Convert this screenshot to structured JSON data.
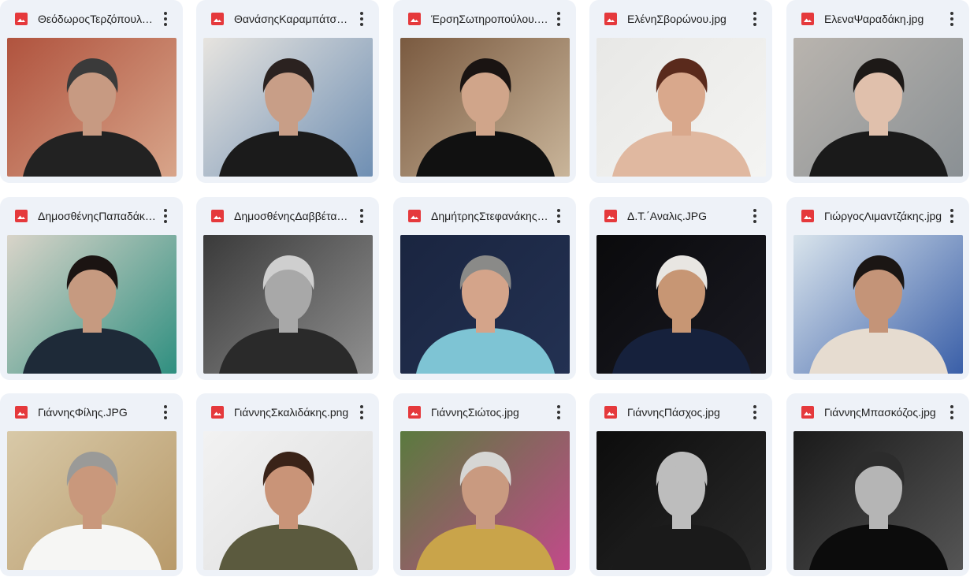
{
  "files": [
    {
      "name": "ΘεόδωροςΤερζόπουλος.jpg",
      "icon": "image-file-icon",
      "colors": {
        "bg": "#b0533e",
        "bg2": "#d8a58a",
        "skin": "#c79a82",
        "hair": "#3a3a3a",
        "shirt": "#222222"
      }
    },
    {
      "name": "ΘανάσηςΚαραμπάτσος.jpg",
      "icon": "image-file-icon",
      "colors": {
        "bg": "#e7e4df",
        "bg2": "#6f8fb3",
        "skin": "#c89e87",
        "hair": "#2b2220",
        "shirt": "#1b1b1b"
      }
    },
    {
      "name": "ΈρσηΣωτηροπούλου.jpg",
      "icon": "image-file-icon",
      "colors": {
        "bg": "#7a5a40",
        "bg2": "#c9b59a",
        "skin": "#d0a58a",
        "hair": "#1a1412",
        "shirt": "#111111"
      }
    },
    {
      "name": "ΕλένηΣβορώνου.jpg",
      "icon": "image-file-icon",
      "colors": {
        "bg": "#e8e8e6",
        "bg2": "#f4f4f2",
        "skin": "#d9a88c",
        "hair": "#5a2a1c",
        "shirt": "#e0b8a0"
      }
    },
    {
      "name": "ΕλεναΨαραδάκη.jpg",
      "icon": "image-file-icon",
      "colors": {
        "bg": "#b9b4ae",
        "bg2": "#8a9094",
        "skin": "#e0c0ac",
        "hair": "#1d1917",
        "shirt": "#1a1a1a"
      }
    },
    {
      "name": "ΔημοσθένηςΠαπαδάκης.jpg",
      "icon": "image-file-icon",
      "colors": {
        "bg": "#d9d4c9",
        "bg2": "#2f8f80",
        "skin": "#c69a80",
        "hair": "#1b1412",
        "shirt": "#1e2a38"
      }
    },
    {
      "name": "ΔημοσθένηςΔαββέτας.jpg",
      "icon": "image-file-icon",
      "colors": {
        "bg": "#3a3a3a",
        "bg2": "#909090",
        "skin": "#a8a8a8",
        "hair": "#cfcfcf",
        "shirt": "#2a2a2a"
      }
    },
    {
      "name": "ΔημήτρηςΣτεφανάκης.jpg",
      "icon": "image-file-icon",
      "colors": {
        "bg": "#1a2540",
        "bg2": "#233152",
        "skin": "#d4a48a",
        "hair": "#8a8a88",
        "shirt": "#7ec4d4"
      }
    },
    {
      "name": "Δ.Τ.΄Αναλις.JPG",
      "icon": "image-file-icon",
      "colors": {
        "bg": "#0a0a0c",
        "bg2": "#1a1a22",
        "skin": "#c79674",
        "hair": "#e8e6e2",
        "shirt": "#16213c"
      }
    },
    {
      "name": "ΓιώργοςΛιμαντζάκης.jpg",
      "icon": "image-file-icon",
      "colors": {
        "bg": "#d9e4ec",
        "bg2": "#3a5fa8",
        "skin": "#c49478",
        "hair": "#1b1614",
        "shirt": "#e6dcd0"
      }
    },
    {
      "name": "ΓιάννηςΦίλης.JPG",
      "icon": "image-file-icon",
      "colors": {
        "bg": "#d8c9a8",
        "bg2": "#b89a6a",
        "skin": "#c9987c",
        "hair": "#9a9a98",
        "shirt": "#f6f6f4"
      }
    },
    {
      "name": "ΓιάννηςΣκαλιδάκης.png",
      "icon": "image-file-icon",
      "colors": {
        "bg": "#f2f2f2",
        "bg2": "#dddddd",
        "skin": "#c99478",
        "hair": "#3a2318",
        "shirt": "#5b5a3e"
      }
    },
    {
      "name": "ΓιάννηςΣιώτος.jpg",
      "icon": "image-file-icon",
      "colors": {
        "bg": "#5a7a3e",
        "bg2": "#c24a8a",
        "skin": "#c99a80",
        "hair": "#d6d6d4",
        "shirt": "#c9a44a"
      }
    },
    {
      "name": "ΓιάννηςΠάσχος.jpg",
      "icon": "image-file-icon",
      "colors": {
        "bg": "#0c0c0c",
        "bg2": "#2a2a2a",
        "skin": "#bdbdbd",
        "hair": "#bdbdbd",
        "shirt": "#1a1a1a"
      }
    },
    {
      "name": "ΓιάννηςΜπασκόζος.jpg",
      "icon": "image-file-icon",
      "colors": {
        "bg": "#1a1a1a",
        "bg2": "#555555",
        "skin": "#b5b5b5",
        "hair": "#2c2c2c",
        "shirt": "#0c0c0c"
      }
    }
  ],
  "more_actions_icon": "more-vert-icon"
}
